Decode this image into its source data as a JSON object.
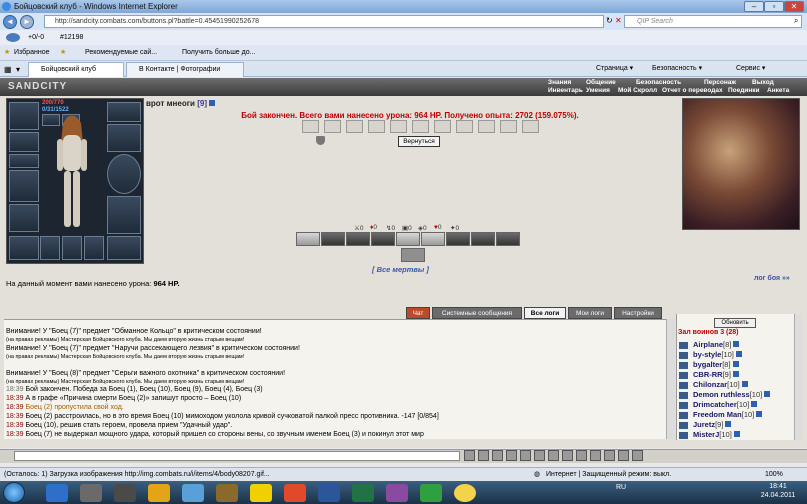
{
  "window": {
    "title": "Бойцовский клуб - Windows Internet Explorer",
    "url": "http://sandcity.combats.com/buttons.pl?battle=0.45451990252678",
    "search_placeholder": "QIP Search"
  },
  "toolbar": {
    "counter": "+0/-0",
    "id_label": "#12198"
  },
  "favorites": {
    "label": "Избранное",
    "links": [
      "Рекомендуемые сай...",
      "Получить больше до..."
    ]
  },
  "tabs": [
    {
      "label": "Бойцовский клуб",
      "active": true
    },
    {
      "label": "В Контакте | Фотографии",
      "active": false
    }
  ],
  "commands": [
    "Страница",
    "Безопасность",
    "Сервис"
  ],
  "game": {
    "logo": "SANDCITY",
    "menu_row1": [
      "Знания",
      "Общение",
      "Безопасность",
      "Персонаж",
      "Выход"
    ],
    "menu_row2": [
      "Инвентарь",
      "Умения",
      "Мой Скролл",
      "Отчет о переводах",
      "Поединки",
      "Анкета"
    ],
    "hp": "200/770",
    "mp": "0/31/1522",
    "opponent_name": "врот мнеоги",
    "opponent_level": "[9]",
    "battle_message": "Бой закончен. Всего вами нанесено урона: 964 HP. Получено опыта: 2702 (159.075%).",
    "back_button": "Вернуться",
    "stats": [
      "0",
      "0",
      "0",
      "0",
      "0",
      "0",
      "0"
    ],
    "dead_link": "[ Все мертвы ]",
    "log_link": "лог боя »»",
    "damage_prefix": "На данный момент вами нанесено урона:",
    "damage_value": "964 HP."
  },
  "chat_tabs": [
    "Чат",
    "Системные сообщения",
    "Все логи",
    "Мои логи",
    "Настройки"
  ],
  "chat_lines": [
    {
      "text": "Внимание! У \"Боец (7)\" предмет \"Обманное Кольцо\" в критическом состоянии!"
    },
    {
      "text": "(на правах рекламы) Мастерская Бойцовского клуба. Мы даем вторую жизнь старым вещам!"
    },
    {
      "text": "Внимание! У \"Боец (7)\" предмет \"Наручи рассекающего лезвия\" в критическом состоянии!"
    },
    {
      "text": "(на правах рекламы) Мастерская Бойцовского клуба. Мы даем вторую жизнь старым вещам!"
    },
    {
      "text": "Внимание! У \"Боец (8)\" предмет \"Серьги важного охотника\" в критическом состоянии!"
    },
    {
      "text": "(на правах рекламы) Мастерская Бойцовского клуба. Мы даем вторую жизнь старым вещам!"
    },
    {
      "time": "18:39",
      "text": "Бой закончен. Победа за Боец (1), Боец (10), Боец (9), Боец (4), Боец (3)"
    },
    {
      "time": "18:39",
      "text": "А в графе «Причина смерти Боец (2)» запишут просто – Боец (10)"
    },
    {
      "time": "18:39",
      "text": "Боец (2) пропустила свой ход."
    },
    {
      "time": "18:39",
      "text": "Боец (2) расстроилась, но в это время Боец (10) мимоходом уколола кривой сучковатой палкой пресс противника. -147 [0/854]"
    },
    {
      "time": "18:39",
      "text": "Боец (10), решив стать героем, провела прием \"Удачный удар\"."
    },
    {
      "time": "18:39",
      "text": "Боец (7) не выдержал мощного удара, который пришел со стороны вены, со звучным именем Боец (3) и покинул этот мир"
    }
  ],
  "room": {
    "refresh_button": "Обновить",
    "title": "Зал воинов 3 (28)",
    "players": [
      {
        "name": "Airplane",
        "level": "[8]"
      },
      {
        "name": "by-style",
        "level": "[10]"
      },
      {
        "name": "bygalter",
        "level": "[8]"
      },
      {
        "name": "CBR-RR",
        "level": "[9]"
      },
      {
        "name": "Chilonzar",
        "level": "[10]"
      },
      {
        "name": "Demon ruthless",
        "level": "[10]"
      },
      {
        "name": "Drimcatcher",
        "level": "[10]"
      },
      {
        "name": "Freedom Man",
        "level": "[10]"
      },
      {
        "name": "Juretz",
        "level": "[9]"
      },
      {
        "name": "MisterJ",
        "level": "[10]"
      }
    ]
  },
  "status_bar": {
    "loading_text": "(Осталось: 1) Загрузка изображения http://img.combats.ru/i/items/4/body08207.gif...",
    "zone": "Интернет | Защищенный режим: выкл.",
    "zoom": "100%"
  },
  "taskbar": {
    "lang": "RU",
    "time": "18:41",
    "date": "24.04.2011"
  }
}
